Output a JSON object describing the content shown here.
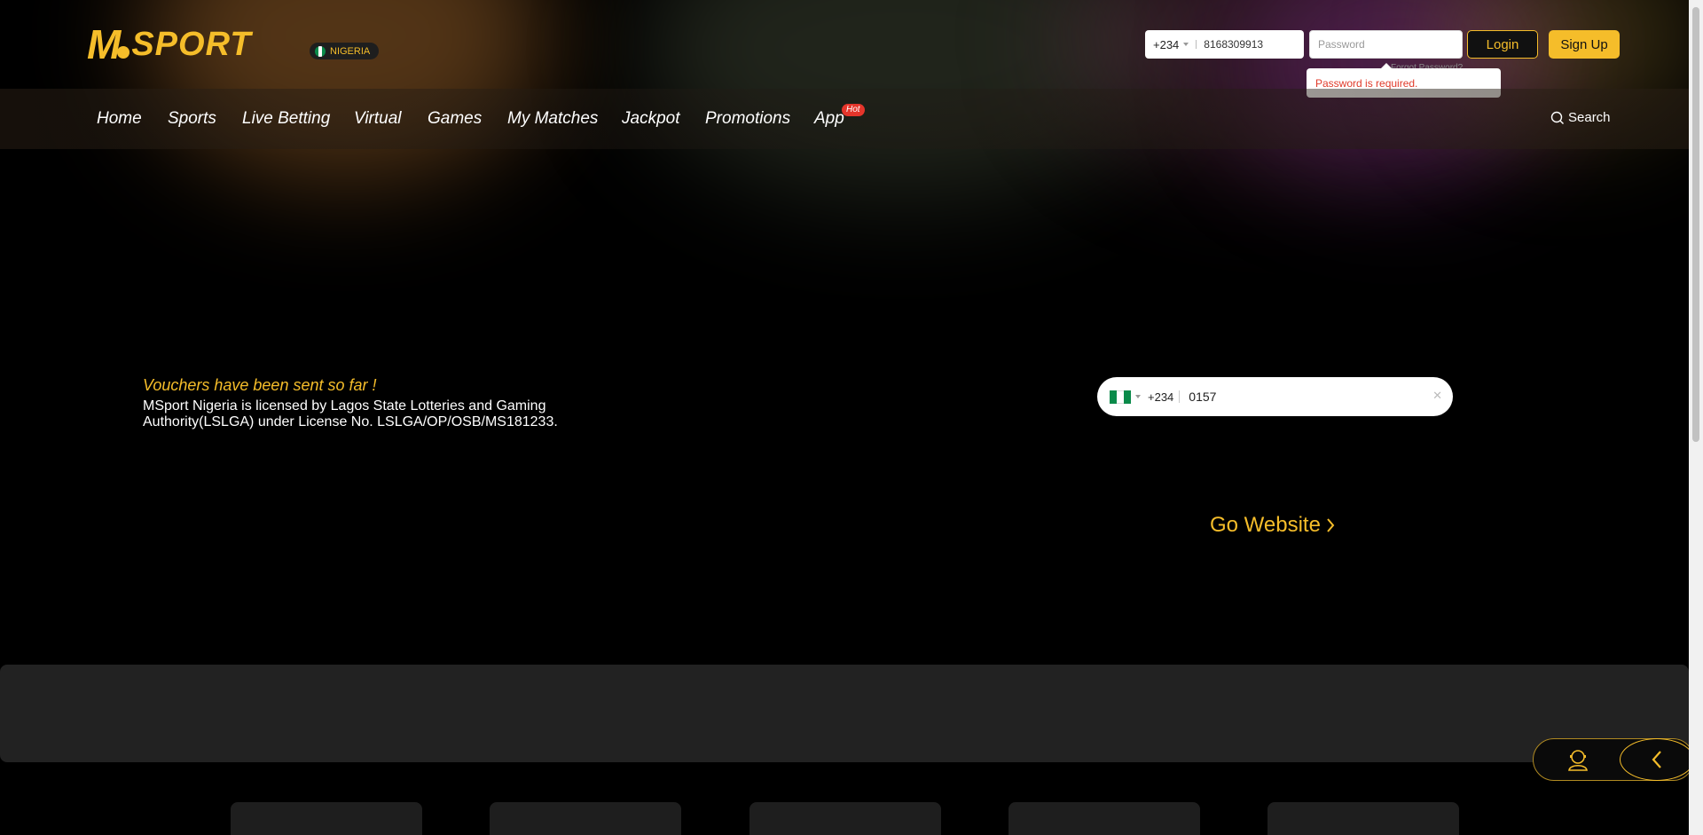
{
  "header": {
    "logo_text": "SPORT",
    "logo_m": "M",
    "country": "NIGERIA",
    "phone_code": "+234",
    "phone_value": "8168309913",
    "password_placeholder": "Password",
    "login_label": "Login",
    "signup_label": "Sign Up",
    "forgot_label": "Forgot Password?",
    "error_tooltip": "Password is required."
  },
  "nav": {
    "items": [
      "Home",
      "Sports",
      "Live Betting",
      "Virtual",
      "Games",
      "My Matches",
      "Jackpot",
      "Promotions",
      "App"
    ],
    "hot_badge": "Hot",
    "search_label": "Search"
  },
  "hero": {
    "vouchers_text": "Vouchers have been sent so far !",
    "license_text": "MSport Nigeria is licensed by Lagos State Lotteries and Gaming Authority(LSLGA) under License No. LSLGA/OP/OSB/MS181233.",
    "phone_code": "+234",
    "phone_value": "0157",
    "clear_icon": "close-icon",
    "go_website_label": "Go Website"
  },
  "colors": {
    "accent": "#f5bd2a",
    "error": "#e03a2a",
    "background": "#000000",
    "panel": "#222222"
  }
}
